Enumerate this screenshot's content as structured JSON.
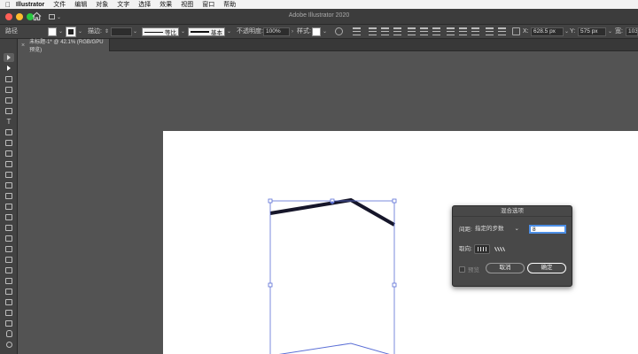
{
  "menubar": {
    "app_name": "Illustrator",
    "items": [
      "文件",
      "编辑",
      "对象",
      "文字",
      "选择",
      "效果",
      "视图",
      "窗口",
      "帮助"
    ]
  },
  "titlebar": {
    "title": "Adobe Illustrator 2020"
  },
  "control_bar": {
    "selection_label": "路径",
    "stroke_label": "描边:",
    "stroke_profile_label": "等比",
    "brush_label": "基本",
    "opacity_label": "不透明度:",
    "opacity_value": "100%",
    "style_label": "样式:",
    "x_label": "X:",
    "x_value": "628.5 px",
    "y_label": "Y:",
    "y_value": "575 px",
    "w_label": "宽:",
    "w_value": "1037 px"
  },
  "document_tab": {
    "label": "未标题-1* @ 42.1% (RGB/GPU 预览)"
  },
  "dialog": {
    "title": "混合选项",
    "spacing_label": "间距:",
    "spacing_option": "指定的步数",
    "steps_value": "8",
    "orientation_label": "取向:",
    "preview_label": "预览",
    "cancel_label": "取消",
    "ok_label": "确定"
  },
  "colors": {
    "selection_blue": "#5b6fd6",
    "canvas_bg": "#535353",
    "artboard": "#ffffff"
  }
}
